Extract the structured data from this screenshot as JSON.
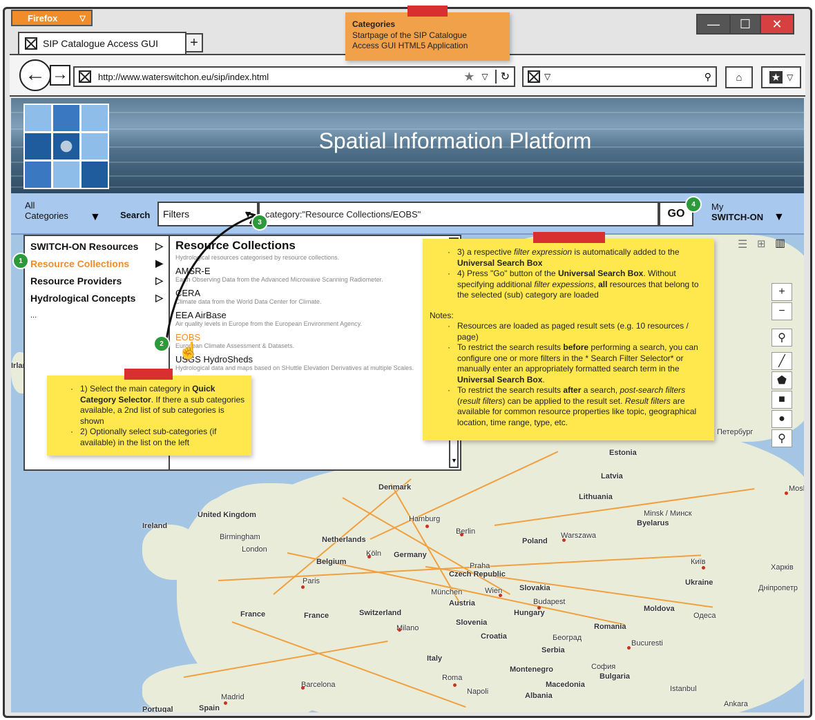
{
  "browser": {
    "app_button": "Firefox",
    "tab_title": "SIP Catalogue Access GUI",
    "new_tab": "+",
    "url": "http://www.waterswitchon.eu/sip/index.html"
  },
  "header": {
    "title": "Spatial Information Platform"
  },
  "toolbar": {
    "all_line1": "All",
    "all_line2": "Categories",
    "search_label": "Search",
    "filters_value": "Filters",
    "search_value": "category:\"Resource Collections/EOBS\"",
    "go_label": "GO",
    "my_line1": "My",
    "my_line2": "SWITCH-ON"
  },
  "categories": {
    "items": [
      {
        "label": "SWITCH-ON Resources"
      },
      {
        "label": "Resource Collections"
      },
      {
        "label": "Resource Providers"
      },
      {
        "label": "Hydrological Concepts"
      },
      {
        "label": "..."
      }
    ]
  },
  "subcategories": {
    "title": "Resource Collections",
    "description": "Hydrological resources categorised by resource collections.",
    "items": [
      {
        "name": "AMSR-E",
        "desc": "Earth Observing Data from the Advanced Microwave Scanning Radiometer."
      },
      {
        "name": "CERA",
        "desc": "Climate data from the World Data Center for Climate."
      },
      {
        "name": "EEA AirBase",
        "desc": "Air quality levels in Europe from the European Environment Agency."
      },
      {
        "name": "EOBS",
        "desc": "European Climate Assessment & Datasets."
      },
      {
        "name": "USGS HydroSheds",
        "desc": "Hydrological data and maps based on SHuttle Elevation Derivatives at multiple Scales."
      }
    ]
  },
  "notes": {
    "top_title": "Categories",
    "top_line1": "Startpage of the SIP Catalogue",
    "top_line2": "Access GUI HTML5 Application",
    "left_1a": "1) Select the main category in ",
    "left_1b": "Quick Category Selector",
    "left_1c": ". If there a sub categories available, a 2nd list of sub categories is shown",
    "left_2": "2) Optionally select sub-categories (if available) in the list on the left",
    "right_3a": "3) a respective ",
    "right_3b": "filter expression",
    "right_3c": " is automatically added to the ",
    "right_3d": "Universal Search Box",
    "right_4a": "4) Press \"Go\" button of the ",
    "right_4b": "Universal Search Box",
    "right_4c": ". Without specifying additional ",
    "right_4d": "filter expessions",
    "right_4e": ", ",
    "right_4f": "all",
    "right_4g": " resources that belong to the selected (sub) category are loaded",
    "notes_label": "Notes:",
    "n1": "Resources are loaded as paged result sets (e.g. 10 resources / page)",
    "n2a": "To restrict the search results ",
    "n2b": "before",
    "n2c": " performing a search, you can configure one or more filters  in the * Search Filter Selector* or manually enter an appropriately formatted search term in the ",
    "n2d": "Universal Search Box",
    "n2e": ".",
    "n3a": "To restrict the search results ",
    "n3b": "after",
    "n3c": " a search, ",
    "n3d": "post-search filters",
    "n3e": " (",
    "n3f": "result filters",
    "n3g": ") can be applied to the result set. ",
    "n3h": "Result filters",
    "n3i": " are available for common resource properties like topic, geographical location, time range, type, etc."
  },
  "badges": [
    "1",
    "2",
    "3",
    "4"
  ],
  "map_labels": [
    "Denmark",
    "United Kingdom",
    "Ireland",
    "Birmingham",
    "London",
    "Hamburg",
    "Berlin",
    "Netherlands",
    "Köln",
    "Germany",
    "Belgium",
    "Poland",
    "Warszawa",
    "Minsk / Минск",
    "Byelarus",
    "Praha",
    "Czech Republic",
    "Paris",
    "München",
    "Wien",
    "Slovakia",
    "Austria",
    "Budapest",
    "France",
    "Switzerland",
    "Hungary",
    "Milano",
    "Slovenia",
    "Croatia",
    "Romania",
    "Moldova",
    "Одеса",
    "Київ",
    "Ukraine",
    "Харків",
    "Дніпропетр",
    "Estonia",
    "Latvia",
    "Lithuania",
    "Italy",
    "Serbia",
    "Београд",
    "Bucuresti",
    "Montenegro",
    "София",
    "Bulgaria",
    "Roma",
    "Napoli",
    "Macedonia",
    "Albania",
    "Barcelona",
    "Madrid",
    "Spain",
    "Portugal",
    "Istanbul",
    "Ankara",
    "Mosk",
    "Петербург",
    "Irlan",
    "France"
  ],
  "colors": {
    "accent": "#f08c2a",
    "toolbar": "#a9c8ee",
    "note": "#ffe84d",
    "badge": "#2c9a3a",
    "tape": "#d83030"
  }
}
